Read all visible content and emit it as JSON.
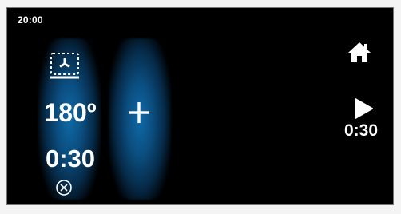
{
  "status_bar": {
    "clock": "20:00"
  },
  "program": {
    "mode_icon": "oven-fan-mode-icon",
    "temperature": "180º",
    "duration": "0:30",
    "cancel_icon": "cancel-circle-icon"
  },
  "add": {
    "icon": "plus-icon"
  },
  "controls": {
    "home_icon": "home-icon",
    "start_icon": "play-icon",
    "start_time": "0:30"
  },
  "colors": {
    "screen_background": "#000000",
    "glow_accent": "#0f6aa6",
    "text": "#ffffff",
    "bezel": "#f4f4f4"
  }
}
